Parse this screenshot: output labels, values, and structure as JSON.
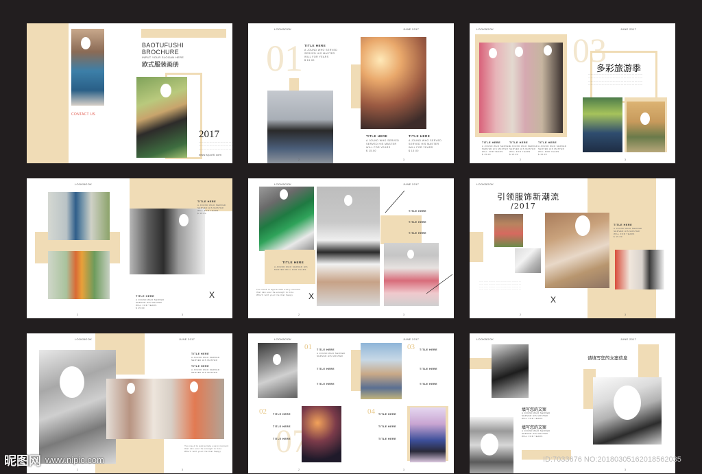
{
  "cover": {
    "brand_line1": "BAOTUFUSHI",
    "brand_line2": "BROCHURE",
    "slogan": "INPUT YOUR SLOGAN HERE",
    "title_cn": "欧式服装画册",
    "contact": "CONTACT US",
    "year": "2017",
    "website": "www.sjuutti.com"
  },
  "common": {
    "lookbook": "LOOKBOOK",
    "june": "JUNE 2017",
    "side_label": "LOOK BOOK",
    "title_here": "TITLE HERE",
    "body_text": "A JOUND WHO SERVED\nSERVED HIS MASTER\nWILL FOR YEARS\n$ 15.00",
    "x_mark": "X"
  },
  "spread2": {
    "num": "01"
  },
  "spread3": {
    "title_cn": "多彩旅游季",
    "num": "03"
  },
  "spread5": {
    "title_block": "TITLE HERE"
  },
  "spread6": {
    "line1": "引领服饰新潮流",
    "line2": "/2017"
  },
  "spread8": {
    "n1": "01",
    "n2": "02",
    "n3": "03",
    "n4": "04"
  },
  "spread9": {
    "heading": "请填写您的文案信息",
    "sub1": "填写您的文案",
    "sub2": "填写您的文案"
  },
  "watermark": {
    "logo": "昵图网",
    "url": "www.nipic.com",
    "id": "ID:7033676 NO:20180305162018562035"
  },
  "colors": {
    "background": "#221e1f",
    "tan": "#f0dcb6",
    "accent_red": "#e0564a"
  }
}
